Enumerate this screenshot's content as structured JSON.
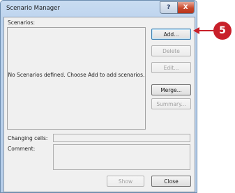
{
  "window": {
    "title": "Scenario Manager",
    "help_label": "?",
    "close_label": "X"
  },
  "scenarios": {
    "label": "Scenarios:",
    "empty_message": "No Scenarios defined.  Choose Add to add scenarios."
  },
  "buttons": {
    "add": "Add...",
    "delete": "Delete",
    "edit": "Edit...",
    "merge": "Merge...",
    "summary": "Summary...",
    "show": "Show",
    "close": "Close"
  },
  "fields": {
    "changing_cells_label": "Changing cells:",
    "changing_cells_value": "",
    "comment_label": "Comment:",
    "comment_value": ""
  },
  "callout": {
    "step_number": "5",
    "color": "#c8202a"
  }
}
